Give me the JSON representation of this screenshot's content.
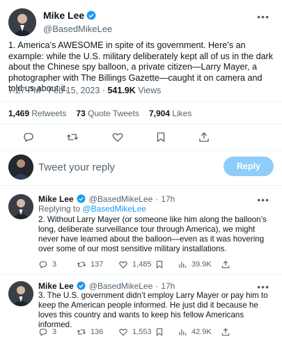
{
  "main_tweet": {
    "name": "Mike Lee",
    "handle": "@BasedMikeLee",
    "text": "1. America’s AWESOME in spite of its government. Here’s an example: while the U.S. military deliberately kept all of us in the dark about the Chinese spy balloon, a private citizen—Larry Mayer, a photographer with The Billings Gazette—caught it on camera and told us about it.",
    "time_date": "7:27 PM · Feb 15, 2023 · ",
    "views_count": "541.9K",
    "views_label": "Views",
    "retweets_count": "1,469",
    "retweets_label": "Retweets",
    "quotes_count": "73",
    "quotes_label": "Quote Tweets",
    "likes_count": "7,904",
    "likes_label": "Likes"
  },
  "reply_box": {
    "placeholder": "Tweet your reply",
    "button": "Reply"
  },
  "replies": [
    {
      "name": "Mike Lee",
      "handle": "@BasedMikeLee",
      "sep": "·",
      "age": "17h",
      "replying_prefix": "Replying to",
      "replying_to": "@BasedMikeLee",
      "text": "2. Without Larry Mayer (or someone like him along the balloon’s long, deliberate surveillance tour through America), we might never have learned about the balloon—even as it was hovering over some of our most sensitive military installations.",
      "reply_count": "3",
      "retweet_count": "137",
      "like_count": "1,485",
      "view_count": "39.9K"
    },
    {
      "name": "Mike Lee",
      "handle": "@BasedMikeLee",
      "sep": "·",
      "age": "17h",
      "text": "3. The U.S. government didn’t employ Larry Mayer or pay him to keep the American people informed. He just did it because he loves this country and wants to keep his fellow Americans informed.",
      "reply_count": "3",
      "retweet_count": "136",
      "like_count": "1,553",
      "view_count": "42.9K"
    }
  ],
  "colors": {
    "accent": "#1d9bf0",
    "secondary_text": "#536471",
    "reply_button_disabled": "#8ecdf8"
  },
  "icons": [
    "verified-badge-icon",
    "more-icon",
    "reply-icon",
    "retweet-icon",
    "like-icon",
    "bookmark-icon",
    "share-icon",
    "views-icon"
  ]
}
